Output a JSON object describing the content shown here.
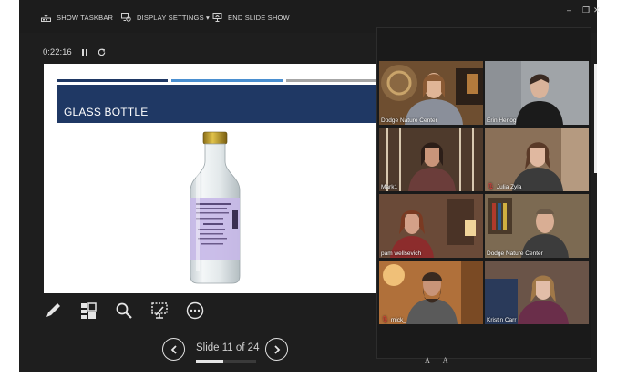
{
  "toolbar": {
    "show_taskbar": "SHOW TASKBAR",
    "display_settings": "DISPLAY SETTINGS ▾",
    "end_slide_show": "END SLIDE SHOW"
  },
  "window_controls": {
    "minimize": "–",
    "restore": "❐",
    "close": "✕"
  },
  "timer": {
    "elapsed": "0:22:16"
  },
  "slide": {
    "title": "GLASS BOTTLE",
    "colors": {
      "banner": "#1f3864",
      "bar1": "#1f3864",
      "bar2": "#4a8fd0",
      "bar3": "#a6a6a6",
      "label": "#c6b8e8"
    }
  },
  "tools": [
    "pen-icon",
    "grid-icon",
    "magnifier-icon",
    "subtitle-icon",
    "more-icon"
  ],
  "navigation": {
    "slide_label": "Slide 11 of 24",
    "current": 11,
    "total": 24,
    "progress": 0.46
  },
  "participants": [
    {
      "name": "Dodge Nature Center",
      "mic_muted": false,
      "active_speaker": true
    },
    {
      "name": "Erin Herlog",
      "mic_muted": false,
      "active_speaker": false
    },
    {
      "name": "Mark1",
      "mic_muted": false,
      "active_speaker": false
    },
    {
      "name": "Julia Zyla",
      "mic_muted": true,
      "active_speaker": false
    },
    {
      "name": "pam wellsevich",
      "mic_muted": false,
      "active_speaker": false
    },
    {
      "name": "Dodge Nature Center",
      "mic_muted": false,
      "active_speaker": false
    },
    {
      "name": "mick_",
      "mic_muted": true,
      "active_speaker": false
    },
    {
      "name": "Kristin Carr",
      "mic_muted": false,
      "active_speaker": false
    }
  ],
  "font_icons": {
    "small": "A",
    "large": "A"
  }
}
